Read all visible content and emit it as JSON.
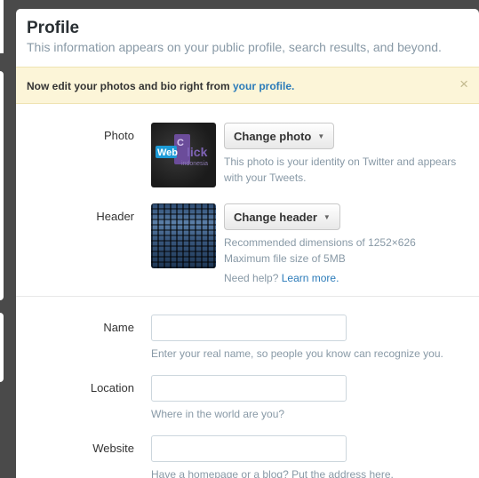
{
  "header": {
    "title": "Profile",
    "subtitle": "This information appears on your public profile, search results, and beyond."
  },
  "notice": {
    "text": "Now edit your photos and bio right from ",
    "link": "your profile.",
    "close": "×"
  },
  "photo": {
    "label": "Photo",
    "button": "Change photo",
    "help_line1": "This photo is your identity on Twitter and appears",
    "help_line2": "with your Tweets.",
    "logo_word1": "Web",
    "logo_word2": "lick",
    "logo_c": "C",
    "logo_sub": "indonesia"
  },
  "header_image": {
    "label": "Header",
    "button": "Change header",
    "help_line1": "Recommended dimensions of 1252×626",
    "help_line2": "Maximum file size of 5MB",
    "need_help": "Need help?",
    "learn_more": "Learn more."
  },
  "fields": {
    "name": {
      "label": "Name",
      "value": "",
      "help": "Enter your real name, so people you know can recognize you."
    },
    "location": {
      "label": "Location",
      "value": "",
      "help": "Where in the world are you?"
    },
    "website": {
      "label": "Website",
      "value": "",
      "help": "Have a homepage or a blog? Put the address here."
    }
  },
  "colors": {
    "link": "#2b7bb9",
    "notice_bg": "#fcf5d8",
    "muted_text": "#8899a6",
    "logo_blue": "#1d9bd7",
    "logo_purple": "#6b4c9a"
  },
  "icons": {
    "caret": "caret-down-icon",
    "close": "close-icon"
  }
}
